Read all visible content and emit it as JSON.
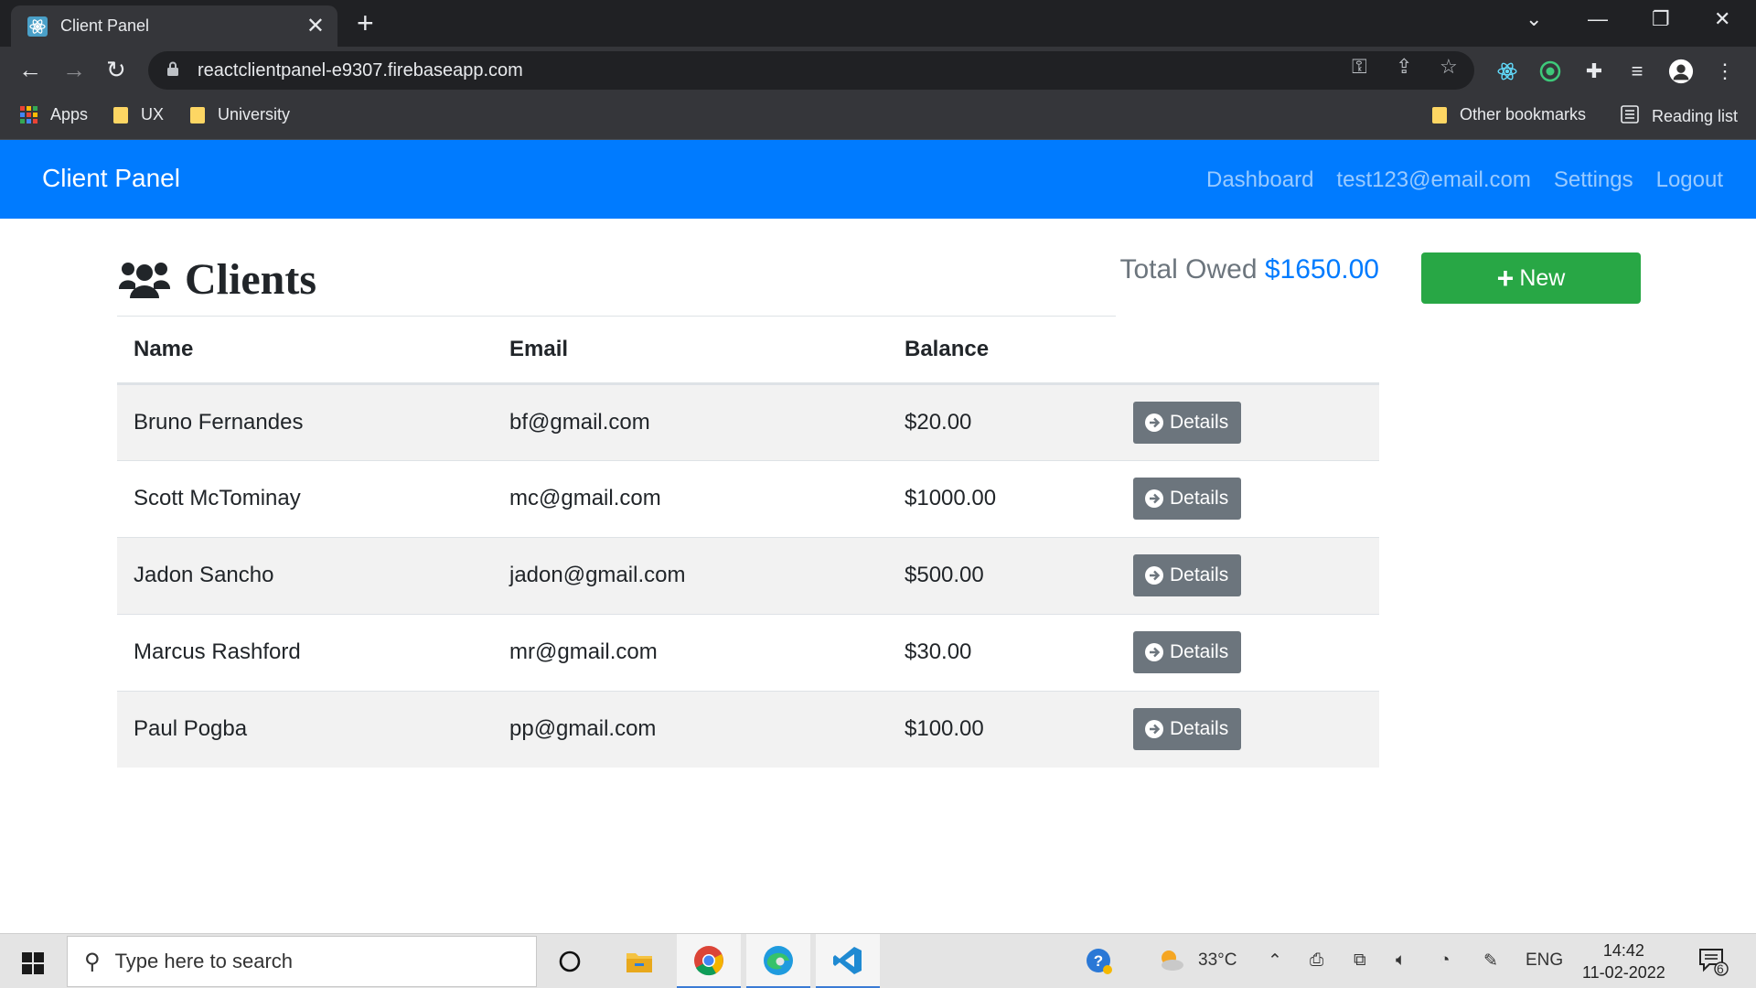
{
  "browser": {
    "tab_title": "Client Panel",
    "url": "reactclientpanel-e9307.firebaseapp.com",
    "bookmarks": [
      {
        "label": "Apps"
      },
      {
        "label": "UX"
      },
      {
        "label": "University"
      }
    ],
    "other_bookmarks": "Other bookmarks",
    "reading_list": "Reading list"
  },
  "app": {
    "brand": "Client Panel",
    "nav": {
      "dashboard": "Dashboard",
      "user": "test123@email.com",
      "settings": "Settings",
      "logout": "Logout"
    },
    "page_title": "Clients",
    "total_label": "Total Owed",
    "total_amount": "$1650.00",
    "new_button": "New",
    "table": {
      "headers": [
        "Name",
        "Email",
        "Balance"
      ],
      "details_label": "Details",
      "rows": [
        {
          "name": "Bruno Fernandes",
          "email": "bf@gmail.com",
          "balance": "$20.00"
        },
        {
          "name": "Scott McTominay",
          "email": "mc@gmail.com",
          "balance": "$1000.00"
        },
        {
          "name": "Jadon Sancho",
          "email": "jadon@gmail.com",
          "balance": "$500.00"
        },
        {
          "name": "Marcus Rashford",
          "email": "mr@gmail.com",
          "balance": "$30.00"
        },
        {
          "name": "Paul Pogba",
          "email": "pp@gmail.com",
          "balance": "$100.00"
        }
      ]
    }
  },
  "taskbar": {
    "search_placeholder": "Type here to search",
    "weather": "33°C",
    "language": "ENG",
    "time": "14:42",
    "date": "11-02-2022",
    "notification_count": "6"
  },
  "colors": {
    "primary": "#007bff",
    "success": "#28a745",
    "secondary": "#6c757d"
  }
}
